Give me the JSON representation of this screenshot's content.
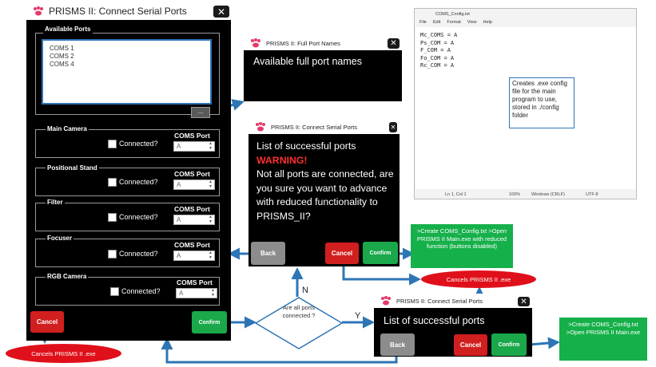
{
  "colors": {
    "window_bg": "#000000",
    "accent_blue": "#2e75b6",
    "cancel_red": "#d11f1f",
    "confirm_green": "#1aa84a",
    "outcome_green": "#16b04a",
    "terminal_red": "#e0101a",
    "warning_red": "#ff3030"
  },
  "icons": {
    "title": "paw-icon",
    "close": "close-icon",
    "checkbox": "checkbox-icon"
  },
  "main_window": {
    "title": "PRISMS II: Connect Serial Ports",
    "available_ports_label": "Available Ports",
    "ports": [
      "COMS 1",
      "COMS 2",
      "COMS 4"
    ],
    "more_button": "...",
    "devices": [
      {
        "name": "Main Camera",
        "checkbox_label": "Connected?",
        "coms_label": "COMS Port",
        "value": "A"
      },
      {
        "name": "Positional Stand",
        "checkbox_label": "Connected?",
        "coms_label": "COMS Port",
        "value": "A"
      },
      {
        "name": "Filter",
        "checkbox_label": "Connected?",
        "coms_label": "COMS Port",
        "value": "A"
      },
      {
        "name": "Focuser",
        "checkbox_label": "Connected?",
        "coms_label": "COMS Port",
        "value": "A"
      },
      {
        "name": "RGB Camera",
        "checkbox_label": "Connected?",
        "coms_label": "COMS Port",
        "value": "A"
      }
    ],
    "cancel": "Cancel",
    "confirm": "Confirm"
  },
  "full_port_window": {
    "title": "PRISMS II: Full Port Names",
    "body": "Available full port names"
  },
  "warning_window": {
    "title": "PRISMS II: Connect Serial Ports",
    "line1": "List of successful ports",
    "warning": "WARNING!",
    "body": "Not all ports are connected, are you sure you want to advance with reduced functionality to PRISMS_II?",
    "back": "Back",
    "cancel": "Cancel",
    "confirm": "Confirm"
  },
  "success_window": {
    "title": "PRISMS II: Connect Serial Ports",
    "body": "List of successful ports",
    "back": "Back",
    "cancel": "Cancel",
    "confirm": "Confirm"
  },
  "notepad": {
    "title": "COMS_Config.txt",
    "menu": [
      "File",
      "Edit",
      "Format",
      "View",
      "Help"
    ],
    "lines": [
      "Mc_COMS = A",
      "Ps_COM = A",
      "F_COM = A",
      "Fo_COM = A",
      "Rc_COM = A"
    ],
    "status": [
      "Ln 1, Col 1",
      "100%",
      "Windows (CRLF)",
      "UTF-8"
    ]
  },
  "config_note": "Creates .exe config file for the main program to use, stored in ./config folder",
  "decision": {
    "text": "Are all ports connected ?",
    "no": "N",
    "yes": "Y"
  },
  "terminals": {
    "cancel_main": "Cancels PRISMS II .exe",
    "cancel_warning": "Cancels PRISMS II .exe"
  },
  "outcomes": {
    "reduced": ">Create COMS_Config.txt >Open PRISMS II Main.exe with reduced function (buttons disabled)",
    "full": ">Create COMS_Config.txt >Open PRISMS II Main.exe"
  }
}
